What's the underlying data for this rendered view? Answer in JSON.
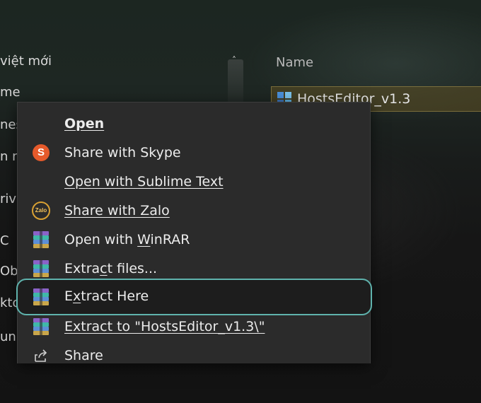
{
  "explorer": {
    "nav_items": [
      "việt mới",
      "me",
      "nes",
      "n n",
      "riv",
      "C",
      "Obj",
      "kto",
      "un"
    ],
    "column_header": "Name",
    "file": {
      "name": "HostsEditor_v1.3"
    }
  },
  "menu": {
    "items": [
      {
        "label": "Open",
        "icon": "none",
        "bold": true
      },
      {
        "label": "Share with Skype",
        "icon": "skype-icon"
      },
      {
        "label": "Open with Sublime Text",
        "icon": "none"
      },
      {
        "label": "Share with Zalo",
        "icon": "zalo-icon",
        "icon_text": "Zalo"
      },
      {
        "label_pre": "Open with ",
        "label_u": "W",
        "label_post": "inRAR",
        "icon": "winrar-icon"
      },
      {
        "label_pre": "Extra",
        "label_u": "c",
        "label_post": "t files...",
        "icon": "winrar-icon"
      },
      {
        "label_pre": "E",
        "label_u": "x",
        "label_post": "tract Here",
        "icon": "winrar-icon",
        "highlighted": true
      },
      {
        "label": "Extract to \"HostsEditor_v1.3\\\"",
        "icon": "winrar-icon"
      },
      {
        "label": "Share",
        "icon": "share-icon"
      }
    ]
  },
  "colors": {
    "menu_bg": "#2b2b2b",
    "highlight_border": "#5fb3ad",
    "skype": "#e65a2b",
    "zalo": "#d9a133"
  }
}
